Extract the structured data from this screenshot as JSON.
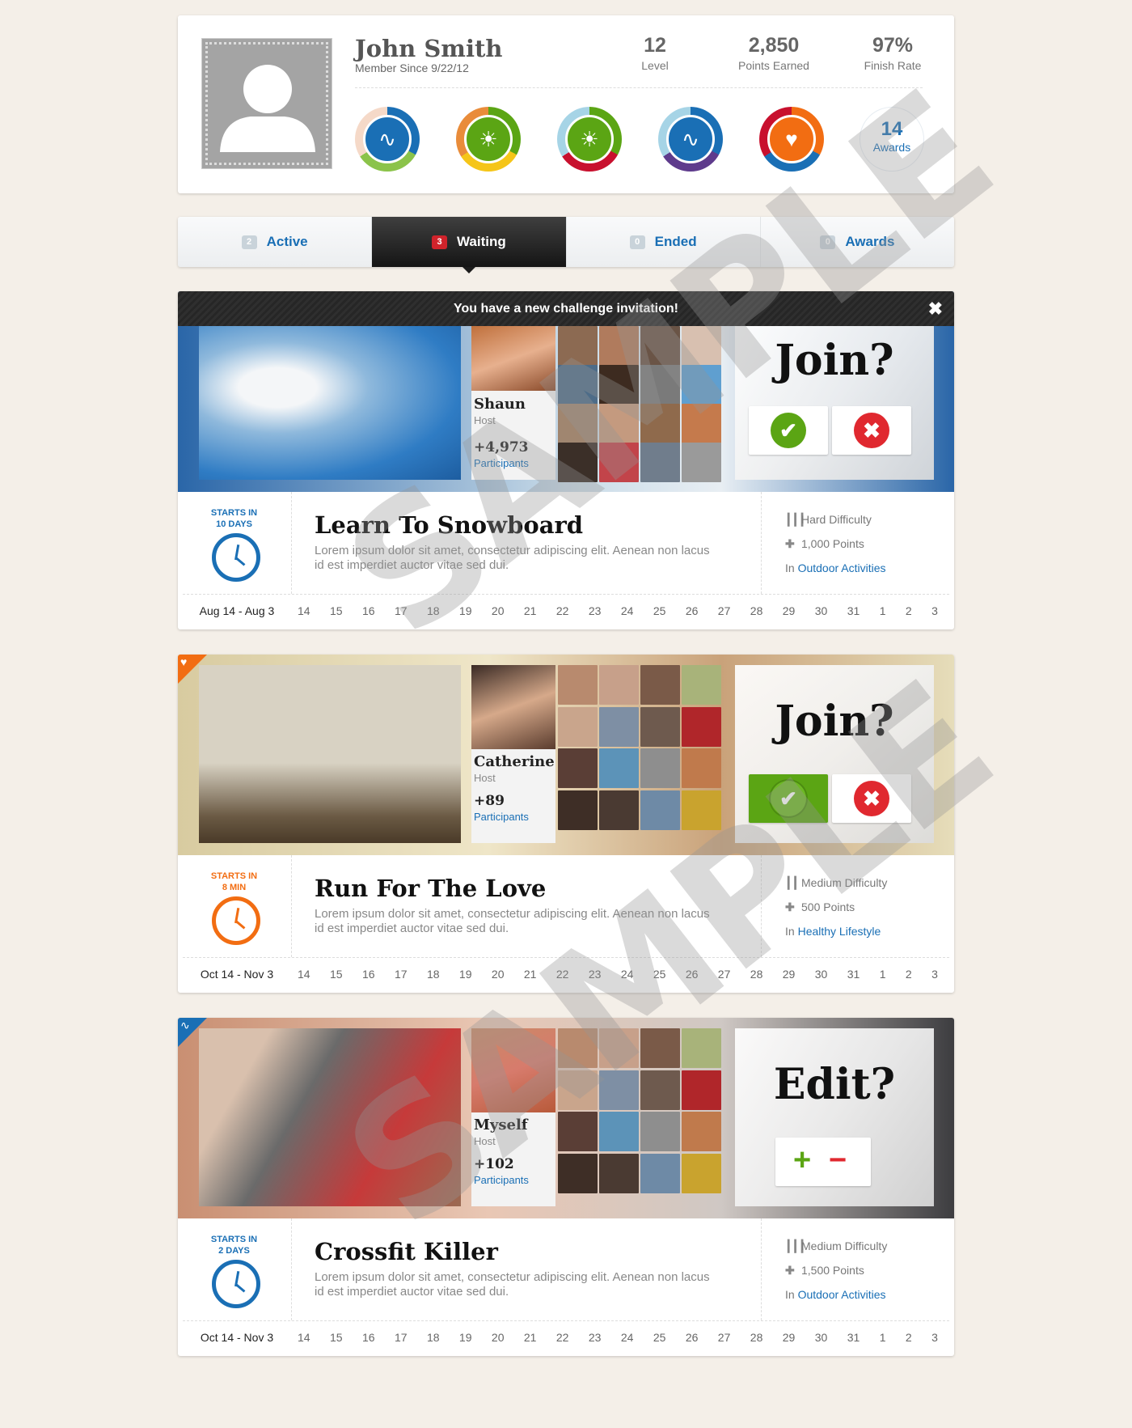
{
  "profile": {
    "name": "John Smith",
    "member_since": "Member Since 9/22/12",
    "stats": [
      {
        "value": "12",
        "label": "Level"
      },
      {
        "value": "2,850",
        "label": "Points Earned"
      },
      {
        "value": "97%",
        "label": "Finish Rate"
      }
    ],
    "badges": [
      {
        "icon": "pulse-icon",
        "colors": [
          "#1a6fb5",
          "#8bc34a",
          "#f5d9c8"
        ]
      },
      {
        "icon": "sun-icon",
        "colors": [
          "#5ba514",
          "#f5c518",
          "#e98c3a"
        ]
      },
      {
        "icon": "sun-icon",
        "colors": [
          "#5ba514",
          "#c8102e",
          "#a6d4e6"
        ]
      },
      {
        "icon": "pulse-icon",
        "colors": [
          "#1a6fb5",
          "#5e3b8c",
          "#a6d4e6"
        ]
      },
      {
        "icon": "heart-icon",
        "colors": [
          "#f26d12",
          "#1a6fb5",
          "#c8102e"
        ]
      }
    ],
    "awards_count": "14",
    "awards_label": "Awards"
  },
  "tabs": [
    {
      "count": "2",
      "label": "Active"
    },
    {
      "count": "3",
      "label": "Waiting"
    },
    {
      "count": "0",
      "label": "Ended"
    },
    {
      "count": "0",
      "label": "Awards"
    }
  ],
  "notice": "You have a new challenge invitation!",
  "colors": {
    "blue": "#1a6fb5",
    "orange": "#f26d12",
    "green": "#5ba514",
    "red": "#e0282f"
  },
  "challenges": [
    {
      "host": "Shaun",
      "host_label": "Host",
      "participants_count": "+4,973",
      "participants_label": "Participants",
      "ask": "Join?",
      "starts": [
        "STARTS IN",
        "10 DAYS"
      ],
      "title": "Learn To Snowboard",
      "desc": "Lorem ipsum dolor sit amet, consectetur adipiscing elit. Aenean non lacus id est imperdiet auctor vitae sed dui.",
      "difficulty": "Hard Difficulty",
      "points": "1,000 Points",
      "in_label": "In",
      "category": "Outdoor Activities",
      "date_range": "Aug 14 - Aug 3",
      "days": [
        "14",
        "15",
        "16",
        "17",
        "18",
        "19",
        "20",
        "21",
        "22",
        "23",
        "24",
        "25",
        "26",
        "27",
        "28",
        "29",
        "30",
        "31",
        "1",
        "2",
        "3"
      ]
    },
    {
      "host": "Catherine",
      "host_label": "Host",
      "participants_count": "+89",
      "participants_label": "Participants",
      "ask": "Join?",
      "starts": [
        "STARTS IN",
        "8 MIN"
      ],
      "title": "Run For The Love",
      "desc": "Lorem ipsum dolor sit amet, consectetur adipiscing elit. Aenean non lacus id est imperdiet auctor vitae sed dui.",
      "difficulty": "Medium Difficulty",
      "points": "500 Points",
      "in_label": "In",
      "category": "Healthy Lifestyle",
      "date_range": "Oct 14 - Nov 3",
      "days": [
        "14",
        "15",
        "16",
        "17",
        "18",
        "19",
        "20",
        "21",
        "22",
        "23",
        "24",
        "25",
        "26",
        "27",
        "28",
        "29",
        "30",
        "31",
        "1",
        "2",
        "3"
      ]
    },
    {
      "host": "Myself",
      "host_label": "Host",
      "participants_count": "+102",
      "participants_label": "Participants",
      "ask": "Edit?",
      "starts": [
        "STARTS IN",
        "2 DAYS"
      ],
      "title": "Crossfit Killer",
      "desc": "Lorem ipsum dolor sit amet, consectetur adipiscing elit. Aenean non lacus id est imperdiet auctor vitae sed dui.",
      "difficulty": "Medium Difficulty",
      "points": "1,500 Points",
      "in_label": "In",
      "category": "Outdoor Activities",
      "date_range": "Oct 14 - Nov 3",
      "days": [
        "14",
        "15",
        "16",
        "17",
        "18",
        "19",
        "20",
        "21",
        "22",
        "23",
        "24",
        "25",
        "26",
        "27",
        "28",
        "29",
        "30",
        "31",
        "1",
        "2",
        "3"
      ]
    }
  ],
  "watermark": "SAMPLE"
}
